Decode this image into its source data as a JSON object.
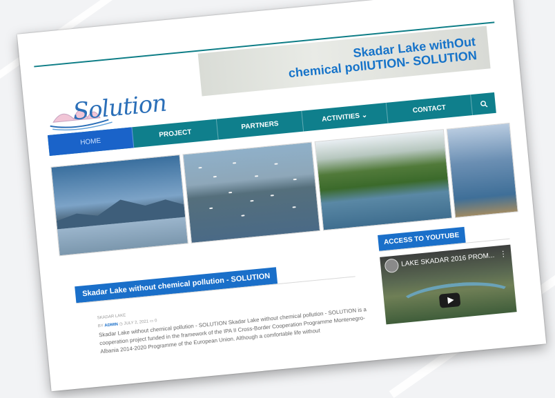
{
  "banner": {
    "line1": "Skadar Lake withOut",
    "line2": "chemical pollUTION- SOLUTION"
  },
  "logo": {
    "text": "Solution"
  },
  "nav": {
    "items": [
      {
        "label": "HOME"
      },
      {
        "label": "PROJECT"
      },
      {
        "label": "PARTNERS"
      },
      {
        "label": "ACTIVITIES ⌄"
      },
      {
        "label": "CONTACT"
      }
    ],
    "search_icon": "search-icon"
  },
  "main": {
    "section_title": "Skadar Lake without chemical pollution - SOLUTION",
    "post": {
      "category": "SKADAR LAKE",
      "by_label": "BY",
      "author": "ADMIN",
      "date": "JULY 2, 2021",
      "comments": "0",
      "excerpt": "Skadar Lake without chemical pollution - SOLUTION Skadar Lake without chemical pollution - SOLUTION is a cooperation project funded in the framework of the IPA II Cross-Border Cooperation Programme Montenegro-Albania 2014-2020 Programme of the European Union. Although a comfortable life without"
    }
  },
  "sidebar": {
    "widget_title": "ACCESS TO YOUTUBE",
    "video_title": "LAKE SKADAR 2016 PROM...",
    "video_menu": "⋮"
  },
  "colors": {
    "accent": "#1a6fc9",
    "nav": "#0f7f8c",
    "banner_text": "#1673c9"
  }
}
